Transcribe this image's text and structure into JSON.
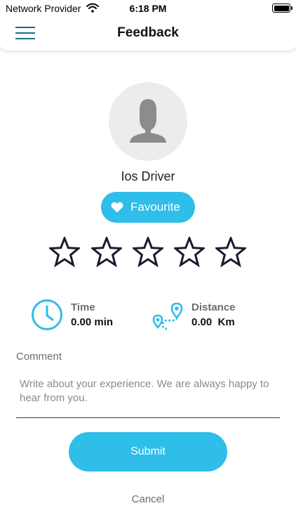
{
  "status_bar": {
    "carrier": "Network Provider",
    "time": "6:18 PM",
    "wifi_icon": "wifi-icon",
    "battery_icon": "battery-icon"
  },
  "header": {
    "title": "Feedback",
    "menu_icon": "hamburger-menu-icon"
  },
  "driver": {
    "name": "Ios Driver",
    "avatar_icon": "person-silhouette-icon"
  },
  "favourite": {
    "label": "Favourite",
    "icon": "heart-icon"
  },
  "rating": {
    "max_stars": 5,
    "selected": 0,
    "icon": "star-outline-icon"
  },
  "stats": {
    "time": {
      "label": "Time",
      "value": "0.00 min",
      "icon": "clock-icon"
    },
    "distance": {
      "label": "Distance",
      "value": "0.00  Km",
      "icon": "route-icon"
    }
  },
  "comment": {
    "label": "Comment",
    "placeholder": "Write about your experience. We are always happy to hear from you.",
    "value": ""
  },
  "actions": {
    "submit_label": "Submit",
    "cancel_label": "Cancel"
  },
  "colors": {
    "accent": "#2fbde9",
    "menu_icon": "#1e6a8a",
    "star_outline": "#1a1a2e",
    "muted_text": "#6d6d6d"
  }
}
